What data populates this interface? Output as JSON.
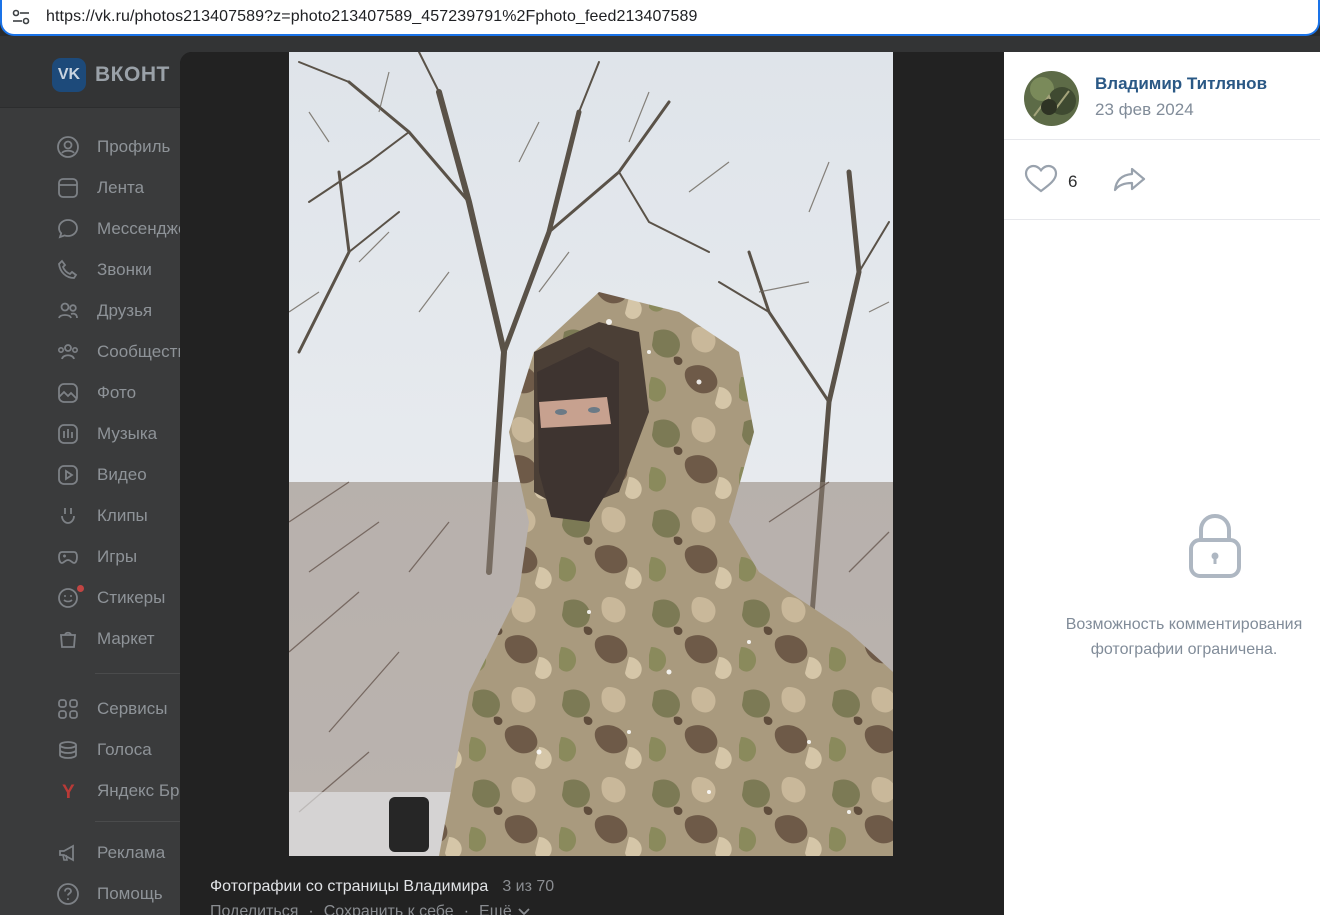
{
  "browser": {
    "url": "https://vk.ru/photos213407589?z=photo213407589_457239791%2Fphoto_feed213407589",
    "site_info_icon": "tune-icon"
  },
  "vk": {
    "logo_text": "ВКОНТ",
    "logo_mark": "VK",
    "sidebar": {
      "group1": [
        {
          "label": "Профиль",
          "icon": "profile-icon"
        },
        {
          "label": "Лента",
          "icon": "feed-icon"
        },
        {
          "label": "Мессенджер",
          "icon": "messenger-icon"
        },
        {
          "label": "Звонки",
          "icon": "phone-icon"
        },
        {
          "label": "Друзья",
          "icon": "friends-icon"
        },
        {
          "label": "Сообщества",
          "icon": "communities-icon"
        },
        {
          "label": "Фото",
          "icon": "photo-icon"
        },
        {
          "label": "Музыка",
          "icon": "music-icon"
        },
        {
          "label": "Видео",
          "icon": "video-icon"
        },
        {
          "label": "Клипы",
          "icon": "clips-icon"
        },
        {
          "label": "Игры",
          "icon": "games-icon"
        },
        {
          "label": "Стикеры",
          "icon": "stickers-icon"
        },
        {
          "label": "Маркет",
          "icon": "market-icon"
        }
      ],
      "group2": [
        {
          "label": "Сервисы",
          "icon": "services-icon"
        },
        {
          "label": "Голоса",
          "icon": "votes-icon"
        },
        {
          "label": "Яндекс Браузер",
          "icon": "yandex-icon"
        }
      ],
      "group3": [
        {
          "label": "Реклама",
          "icon": "ads-icon"
        },
        {
          "label": "Помощь",
          "icon": "help-icon"
        }
      ]
    }
  },
  "viewer": {
    "caption_title": "Фотографии со страницы Владимира",
    "counter": "3 из 70",
    "actions": {
      "share": "Поделиться",
      "save": "Сохранить к себе",
      "more": "Ещё"
    },
    "author_name": "Владимир Титлянов",
    "date": "23 фев 2024",
    "likes": "6",
    "comments_restricted_line1": "Возможность комментирования",
    "comments_restricted_line2": "фотографии ограничена."
  },
  "colors": {
    "accent_border": "#1a73e8",
    "author_link": "#2a5885",
    "muted": "#818c99"
  }
}
